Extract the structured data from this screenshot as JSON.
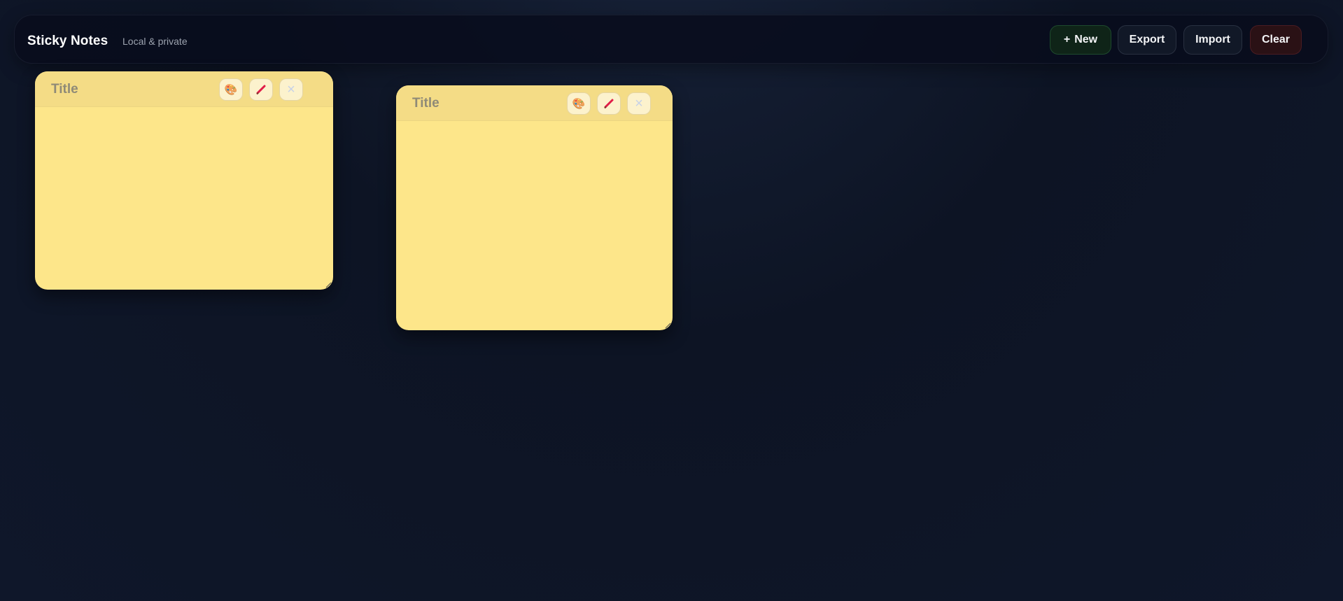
{
  "app": {
    "title": "Sticky Notes",
    "subtitle": "Local & private"
  },
  "toolbar": {
    "new_label": "New",
    "new_icon": "+",
    "export_label": "Export",
    "import_label": "Import",
    "clear_label": "Clear"
  },
  "notes": [
    {
      "title_placeholder": "Title",
      "color": "#fde68a"
    },
    {
      "title_placeholder": "Title",
      "color": "#fde68a"
    }
  ],
  "icons": {
    "palette": "palette-icon",
    "pencil": "pencil-icon",
    "close": "close-icon"
  },
  "colors": {
    "background": "#0f172a",
    "note_yellow": "#fde68a",
    "new_button": "#0f2418",
    "clear_button": "#2a1115"
  }
}
